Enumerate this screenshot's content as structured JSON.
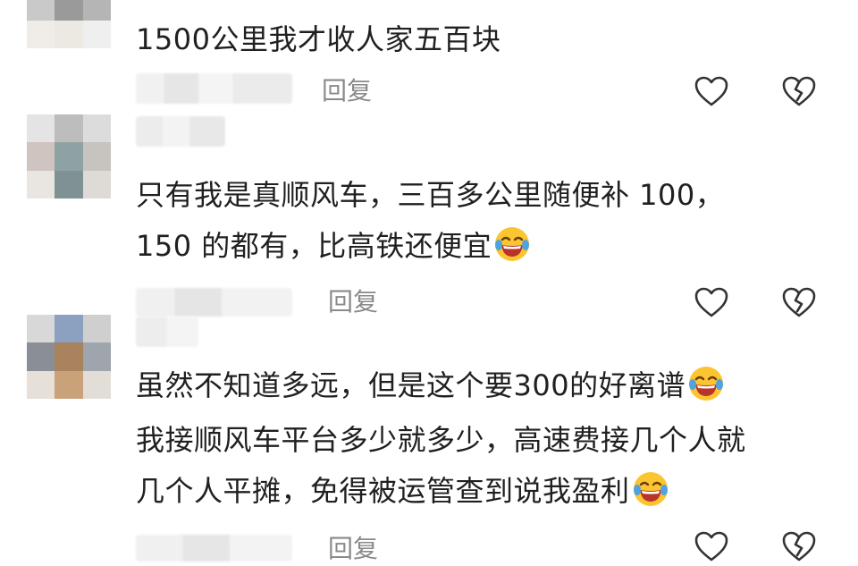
{
  "comments": [
    {
      "lines": [
        "1500公里我才收人家五百块"
      ],
      "reply_label": "回复",
      "like_icon": "heart-outline-icon",
      "dislike_icon": "broken-heart-outline-icon"
    },
    {
      "lines": [
        "只有我是真顺风车，三百多公里随便补 100，",
        "150 的都有，比高铁还便宜"
      ],
      "emoji": "laughing-tears-emoji",
      "reply_label": "回复",
      "like_icon": "heart-outline-icon",
      "dislike_icon": "broken-heart-outline-icon"
    },
    {
      "lines": [
        "虽然不知道多远，但是这个要300的好离谱",
        "我接顺风车平台多少就多少，高速费接几个人就",
        "几个人平摊，免得被运管查到说我盈利"
      ],
      "emoji": "laughing-tears-emoji",
      "reply_label": "回复",
      "like_icon": "heart-outline-icon",
      "dislike_icon": "broken-heart-outline-icon"
    }
  ]
}
